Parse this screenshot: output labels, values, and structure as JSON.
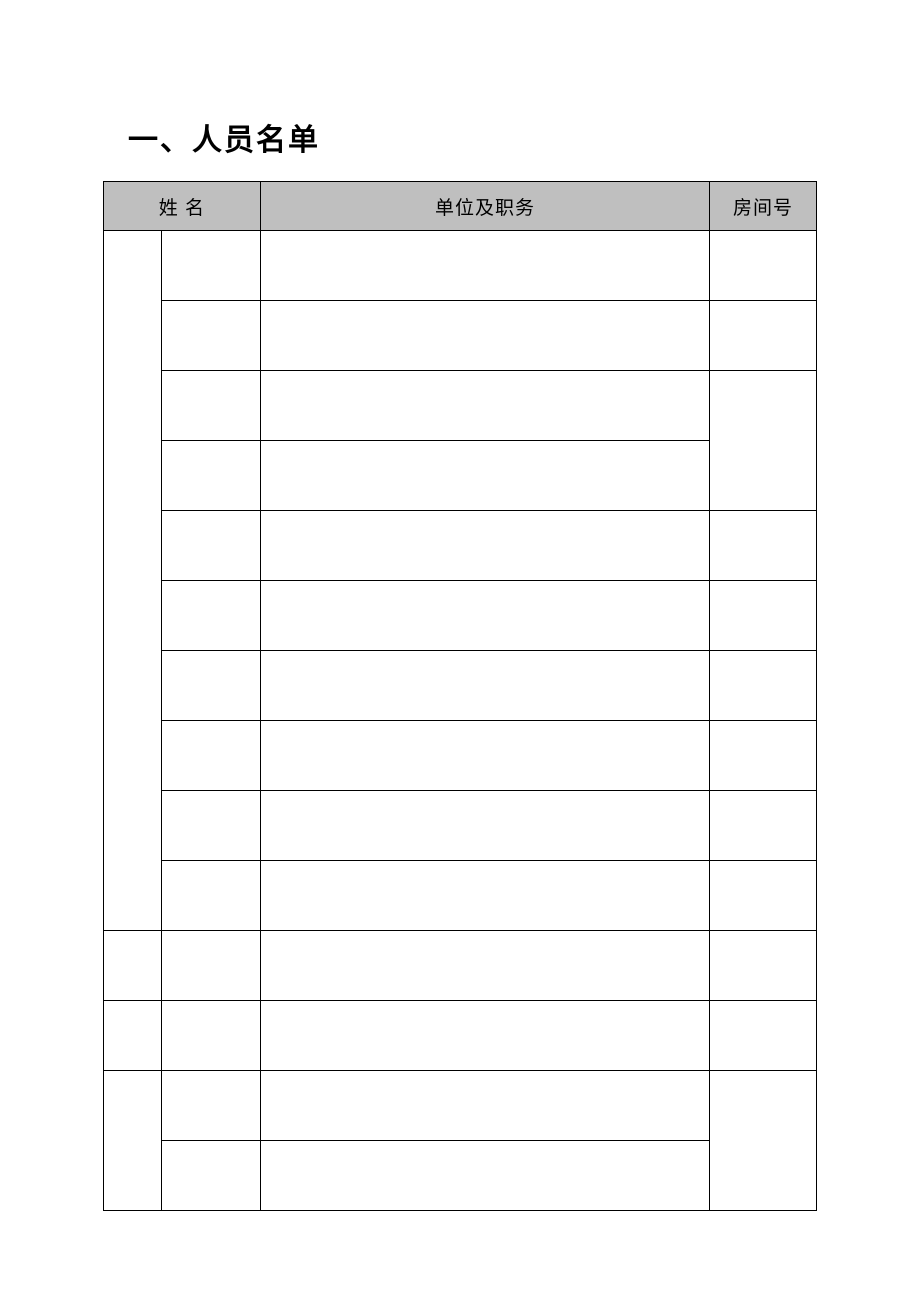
{
  "title": "一、人员名单",
  "headers": {
    "name": "姓  名",
    "unit": "单位及职务",
    "room": "房间号"
  },
  "rows": [
    {
      "group": "",
      "name": "",
      "unit": "",
      "room": ""
    },
    {
      "group": "",
      "name": "",
      "unit": "",
      "room": ""
    },
    {
      "group": "",
      "name": "",
      "unit": "",
      "room": ""
    },
    {
      "group": "",
      "name": "",
      "unit": "",
      "room": ""
    },
    {
      "group": "",
      "name": "",
      "unit": "",
      "room": ""
    },
    {
      "group": "",
      "name": "",
      "unit": "",
      "room": ""
    },
    {
      "group": "",
      "name": "",
      "unit": "",
      "room": ""
    },
    {
      "group": "",
      "name": "",
      "unit": "",
      "room": ""
    },
    {
      "group": "",
      "name": "",
      "unit": "",
      "room": ""
    },
    {
      "group": "",
      "name": "",
      "unit": "",
      "room": ""
    },
    {
      "group": "",
      "name": "",
      "unit": "",
      "room": ""
    },
    {
      "group": "",
      "name": "",
      "unit": "",
      "room": ""
    },
    {
      "group": "",
      "name": "",
      "unit": "",
      "room": ""
    },
    {
      "group": "",
      "name": "",
      "unit": "",
      "room": ""
    }
  ]
}
